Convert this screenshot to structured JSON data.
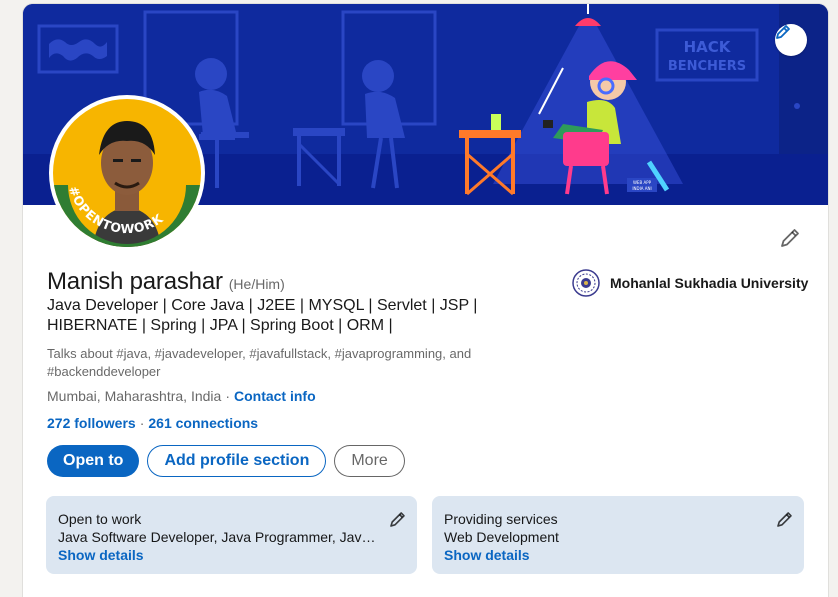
{
  "banner": {
    "sign_line1": "HACK",
    "sign_line2": "BENCHERS",
    "sticker_line1": "WEB APP",
    "sticker_line2": "INDIA ANI"
  },
  "avatar": {
    "badge_text": "#OPENTOWORK"
  },
  "profile": {
    "name": "Manish parashar",
    "pronouns": "(He/Him)",
    "headline": "Java Developer | Core Java | J2EE | MYSQL | Servlet | JSP | HIBERNATE | Spring | JPA | Spring Boot | ORM |",
    "talks_about": "Talks about #java, #javadeveloper, #javafullstack, #javaprogramming, and #backenddeveloper",
    "location": "Mumbai, Maharashtra, India",
    "contact_label": "Contact info",
    "followers": "272 followers",
    "connections": "261 connections"
  },
  "education": {
    "name": "Mohanlal Sukhadia University"
  },
  "actions": {
    "open_to": "Open to",
    "add_section": "Add profile section",
    "more": "More"
  },
  "panels": {
    "open_to_work": {
      "title": "Open to work",
      "body": "Java Software Developer, Java Programmer, Java S...",
      "link": "Show details"
    },
    "providing_services": {
      "title": "Providing services",
      "body": "Web Development",
      "link": "Show details"
    }
  },
  "colors": {
    "accent": "#0a66c2",
    "banner": "#0f2a9e",
    "panel_bg": "#dce6f1",
    "open_to_work_green": "#2f7d32"
  }
}
